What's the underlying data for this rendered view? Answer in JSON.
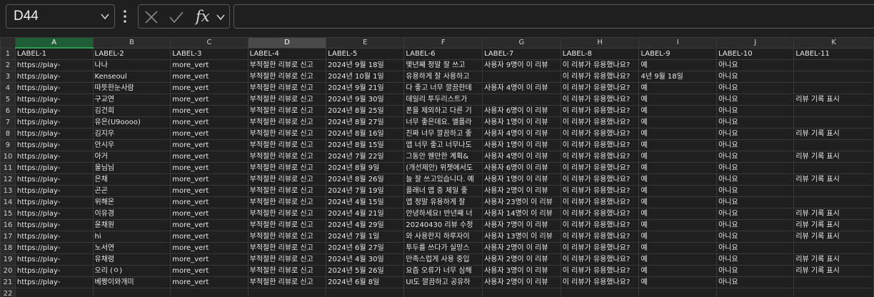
{
  "name_box": {
    "value": "D44"
  },
  "formula": {
    "fx_label": "fx",
    "value": ""
  },
  "columns": [
    "A",
    "B",
    "C",
    "D",
    "E",
    "F",
    "G",
    "H",
    "I",
    "J",
    "K"
  ],
  "rows": [
    [
      "LABEL-1",
      "LABEL-2",
      "LABEL-3",
      "LABEL-4",
      "LABEL-5",
      "LABEL-6",
      "LABEL-7",
      "LABEL-8",
      "LABEL-9",
      "LABEL-10",
      "LABEL-11"
    ],
    [
      "https://play-",
      "나나",
      "more_vert",
      "부적절한 리뷰로 신고",
      "2024년 9월 18일",
      "몇년째 정말 잘 쓰고",
      "사용자 9명이 이 리뷰",
      "이 리뷰가 유용했나요?",
      "예",
      "아니요",
      ""
    ],
    [
      "https://play-",
      "Kenseoul",
      "more_vert",
      "부적절한 리뷰로 신고",
      "2024년 10월 1일",
      "유용하게 잘 사용하고",
      "",
      "이 리뷰가 유용했나요?",
      "4년 9월 18일",
      "아니요",
      ""
    ],
    [
      "https://play-",
      "따뜻한눈사람",
      "more_vert",
      "부적절한 리뷰로 신고",
      "2024년 9월 21일",
      "다 좋고 너무 깔끔한데",
      "사용자 4명이 이 리뷰",
      "이 리뷰가 유용했나요?",
      "예",
      "아니요",
      ""
    ],
    [
      "https://play-",
      "구교연",
      "more_vert",
      "부적절한 리뷰로 신고",
      "2024년 9월 30일",
      "데일리 투두리스트가",
      "",
      "이 리뷰가 유용했나요?",
      "예",
      "아니요",
      "리뷰 기록 표시"
    ],
    [
      "https://play-",
      "김건희",
      "more_vert",
      "부적절한 리뷰로 신고",
      "2024년 8월 25일",
      "폰을 제외하고 다른 기",
      "사용자 6명이 이 리뷰",
      "이 리뷰가 유용했나요?",
      "예",
      "아니요",
      ""
    ],
    [
      "https://play-",
      "유은(U9oooo)",
      "more_vert",
      "부적절한 리뷰로 신고",
      "2024년 8월 27일",
      "너무 좋은데요. 엘플라",
      "사용자 1명이 이 리뷰",
      "이 리뷰가 유용했나요?",
      "예",
      "아니요",
      ""
    ],
    [
      "https://play-",
      "김지우",
      "more_vert",
      "부적절한 리뷰로 신고",
      "2024년 8월 16일",
      "진짜 너무 깔끔하고 좋",
      "사용자 4명이 이 리뷰",
      "이 리뷰가 유용했나요?",
      "예",
      "아니요",
      "리뷰 기록 표시"
    ],
    [
      "https://play-",
      "안시우",
      "more_vert",
      "부적절한 리뷰로 신고",
      "2024년 8월 15일",
      "앱 너무 좋고 너무나도",
      "사용자 1명이 이 리뷰",
      "이 리뷰가 유용했나요?",
      "예",
      "아니요",
      ""
    ],
    [
      "https://play-",
      "아거",
      "more_vert",
      "부적절한 리뷰로 신고",
      "2024년 7월 22일",
      "그동안 웬만한 계획&",
      "사용자 4명이 이 리뷰",
      "이 리뷰가 유용했나요?",
      "예",
      "아니요",
      "리뷰 기록 표시"
    ],
    [
      "https://play-",
      "울님님",
      "more_vert",
      "부적절한 리뷰로 신고",
      "2024년 8월 9일",
      "(개선제안) 위젯에서도",
      "사용자 6명이 이 리뷰",
      "이 리뷰가 유용했나요?",
      "예",
      "아니요",
      ""
    ],
    [
      "https://play-",
      "은채",
      "more_vert",
      "부적절한 리뷰로 신고",
      "2024년 8월 26일",
      "늘 잘 쓰고있습니다. 예",
      "사용자 1명이 이 리뷰",
      "이 리뷰가 유용했나요?",
      "예",
      "아니요",
      "리뷰 기록 표시"
    ],
    [
      "https://play-",
      "곤곤",
      "more_vert",
      "부적절한 리뷰로 신고",
      "2024년 7월 19일",
      "플래너 앱 중 제일 좋",
      "사용자 2명이 이 리뷰",
      "이 리뷰가 유용했나요?",
      "예",
      "아니요",
      ""
    ],
    [
      "https://play-",
      "위해온",
      "more_vert",
      "부적절한 리뷰로 신고",
      "2024년 4월 15일",
      "앱 정말 유용하게 잘",
      "사용자 23명이 이 리뷰",
      "이 리뷰가 유용했나요?",
      "예",
      "아니요",
      ""
    ],
    [
      "https://play-",
      "이유경",
      "more_vert",
      "부적절한 리뷰로 신고",
      "2024년 4월 21일",
      "안녕하세요! 반년째 너",
      "사용자 14명이 이 리뷰",
      "이 리뷰가 유용했나요?",
      "예",
      "아니요",
      "리뷰 기록 표시"
    ],
    [
      "https://play-",
      "윤채원",
      "more_vert",
      "부적절한 리뷰로 신고",
      "2024년 4월 29일",
      "20240430 리뷰 수정",
      "사용자 7명이 이 리뷰",
      "이 리뷰가 유용했나요?",
      "예",
      "아니요",
      "리뷰 기록 표시"
    ],
    [
      "https://play-",
      "hi",
      "more_vert",
      "부적절한 리뷰로 신고",
      "2024년 7월 1일",
      "와 사용한지 하루자이",
      "사용자 13명이 이 리뷰",
      "이 리뷰가 유용했나요?",
      "예",
      "아니요",
      "리뷰 기록 표시"
    ],
    [
      "https://play-",
      "노서연",
      "more_vert",
      "부적절한 리뷰로 신고",
      "2024년 6월 27일",
      "투두를 쓰다가 실망스",
      "사용자 2명이 이 리뷰",
      "이 리뷰가 유용했나요?",
      "예",
      "아니요",
      ""
    ],
    [
      "https://play-",
      "유채령",
      "more_vert",
      "부적절한 리뷰로 신고",
      "2024년 4월 30일",
      "만족스럽게 사용 중입",
      "사용자 2명이 이 리뷰",
      "이 리뷰가 유용했나요?",
      "예",
      "아니요",
      "리뷰 기록 표시"
    ],
    [
      "https://play-",
      "오리 (ㅇ)",
      "more_vert",
      "부적절한 리뷰로 신고",
      "2024년 5월 26일",
      "요즘 오류가 너무 심해",
      "사용자 3명이 이 리뷰",
      "이 리뷰가 유용했나요?",
      "예",
      "아니요",
      "리뷰 기록 표시"
    ],
    [
      "https://play-",
      "베짱이와개미",
      "more_vert",
      "부적절한 리뷰로 신고",
      "2024년 6월 8일",
      "UI도 깔끔하고 공유하",
      "사용자 2명이 이 리뷰",
      "이 리뷰가 유용했나요?",
      "예",
      "아니요",
      ""
    ],
    [
      "",
      "",
      "",
      "",
      "",
      "",
      "",
      "",
      "",
      "",
      ""
    ]
  ],
  "colors": {
    "background": "#1f1f1f",
    "selected_column_header": "#1e5c35",
    "active_column_header": "#4a4a4a"
  },
  "icons": {
    "name_box_dropdown": "chevron-down-icon",
    "more": "vertical-dots-icon",
    "cancel": "close-icon",
    "enter": "check-icon",
    "function": "fx-icon"
  }
}
